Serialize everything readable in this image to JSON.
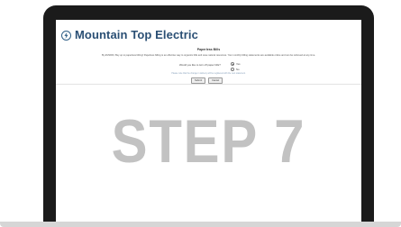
{
  "brand": {
    "name": "Mountain Top Electric",
    "logo_icon": "lightning-bolt-icon",
    "color": "#2a4f74"
  },
  "form": {
    "title": "Paperless Bills",
    "description": "By EVNDIN, Buy up to paperless billing! Paperless billing is an effective way to organize bills and save natural resources. Your monthly billing statements are available online and can be retrieved at any time.",
    "question": "Would you like to turn off paper bills?",
    "options": [
      {
        "label": "Yes",
        "selected": true
      },
      {
        "label": "No",
        "selected": false
      }
    ],
    "note": "Please note that the change in delivery will be registered with the next statement.",
    "buttons": {
      "submit": "Submit",
      "cancel": "Cancel"
    }
  },
  "overlay": {
    "step_text": "STEP 7"
  }
}
